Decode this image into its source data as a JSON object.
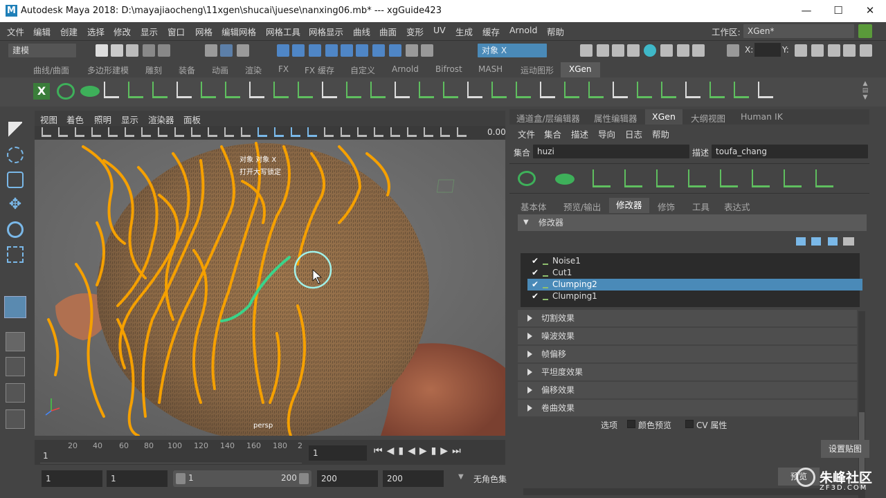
{
  "window": {
    "title": "Autodesk Maya 2018: D:\\mayajiaocheng\\11xgen\\shucai\\juese\\nanxing06.mb*   ---   xgGuide423",
    "logo": "M"
  },
  "menubar": {
    "items": [
      "文件",
      "编辑",
      "创建",
      "选择",
      "修改",
      "显示",
      "窗口",
      "网格",
      "编辑网格",
      "网格工具",
      "网格显示",
      "曲线",
      "曲面",
      "变形",
      "UV",
      "生成",
      "缓存",
      "Arnold",
      "帮助"
    ],
    "workspace_label": "工作区:",
    "workspace_value": "XGen*"
  },
  "status": {
    "mode": "建模",
    "object_field": "对象 X",
    "x_label": "X:",
    "y_label": "Y:"
  },
  "shelf_tabs": [
    "曲线/曲面",
    "多边形建模",
    "雕刻",
    "装备",
    "动画",
    "渲染",
    "FX",
    "FX 缓存",
    "自定义",
    "Arnold",
    "Bifrost",
    "MASH",
    "运动图形",
    "XGen"
  ],
  "shelf_active": "XGen",
  "viewport": {
    "menu": [
      "视图",
      "着色",
      "照明",
      "显示",
      "渲染器",
      "面板"
    ],
    "value_readout": "0.00",
    "hud_line1": "对象 对象 X",
    "hud_line2": "打开大写锁定",
    "camera": "persp"
  },
  "timeline": {
    "ticks": [
      "20",
      "40",
      "60",
      "80",
      "100",
      "120",
      "140",
      "160",
      "180",
      "2"
    ],
    "start": "1",
    "current": "1"
  },
  "range": {
    "start": "1",
    "anim_start": "1",
    "slider_start": "1",
    "slider_end": "200",
    "end": "200",
    "anim_end": "200",
    "char_set": "无角色集"
  },
  "panel": {
    "tabs": [
      "通道盒/层编辑器",
      "属性编辑器",
      "XGen",
      "大纲视图",
      "Human IK"
    ],
    "active_tab": "XGen",
    "menu": [
      "文件",
      "集合",
      "描述",
      "导向",
      "日志",
      "帮助"
    ],
    "collection_label": "集合",
    "collection_value": "huzi",
    "description_label": "描述",
    "description_value": "toufa_chang",
    "subtabs": [
      "基本体",
      "预览/输出",
      "修改器",
      "修饰",
      "工具",
      "表达式"
    ],
    "active_subtab": "修改器",
    "section_title": "修改器",
    "modifiers": [
      {
        "name": "Noise1",
        "checked": "✔"
      },
      {
        "name": "Cut1",
        "checked": "✔"
      },
      {
        "name": "Clumping2",
        "checked": "✔"
      },
      {
        "name": "Clumping1",
        "checked": "✔"
      }
    ],
    "selected_modifier": "Clumping2",
    "sections": [
      "切割效果",
      "噪波效果",
      "帧偏移",
      "平坦度效果",
      "偏移效果",
      "卷曲效果"
    ],
    "options_label": "选项",
    "color_preview": "颜色预览",
    "cv_attr": "CV 属性",
    "set_map_button": "设置贴图",
    "preview_button": "预览"
  },
  "watermark": {
    "brand": "朱峰社区",
    "url": "ZF3D.COM"
  },
  "colors": {
    "accent": "#4a8ab8",
    "hair": "#f5a000",
    "guide": "#3ad48a",
    "scalp": "#a07850"
  }
}
